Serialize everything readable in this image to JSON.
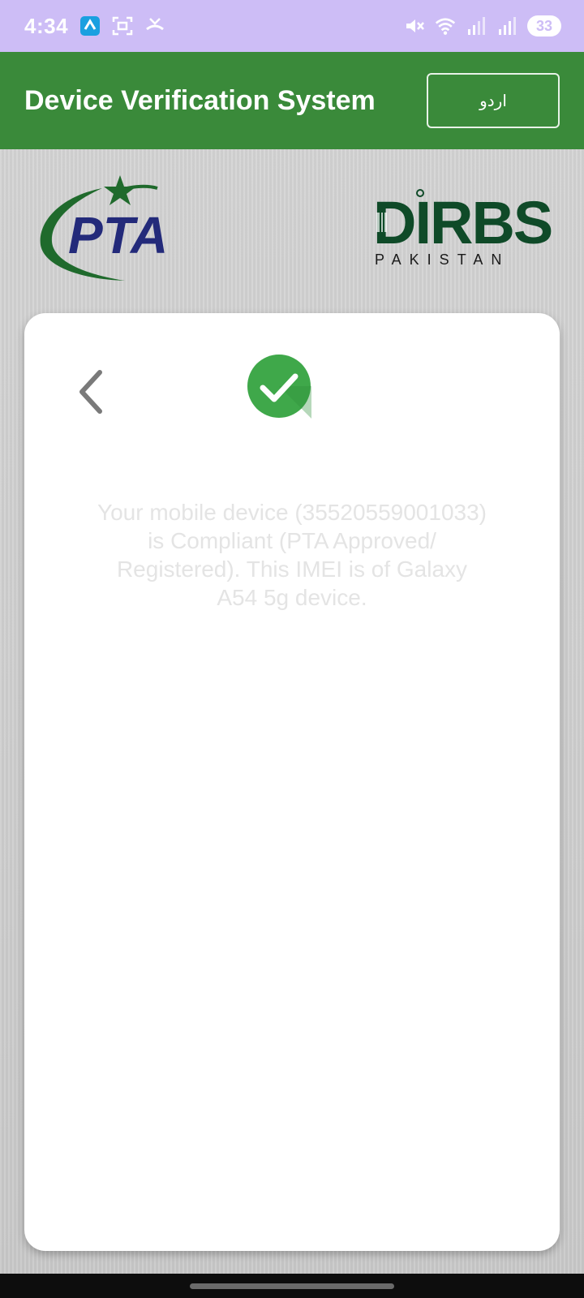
{
  "status_bar": {
    "time": "4:34",
    "battery": "33",
    "icons": [
      "telenor-icon",
      "screenshot-icon",
      "missed-call-icon",
      "mute-icon",
      "wifi-icon",
      "signal-icon",
      "signal-icon-2"
    ]
  },
  "app_bar": {
    "title": "Device Verification System",
    "language_button": "اردو"
  },
  "logos": {
    "left": "PTA",
    "right_main": "DIRBS",
    "right_sub": "PAKISTAN"
  },
  "result": {
    "status_icon": "check-icon",
    "message": "Your mobile device (35520559001033) is Compliant (PTA Approved/ Registered). This IMEI is of Galaxy A54 5g device."
  },
  "colors": {
    "status_bar": "#cdbdf6",
    "app_bar": "#3a8a3a",
    "check": "#3fa84a",
    "pta_blue": "#232a7a",
    "pta_green": "#1f6a2c",
    "dirbs_green": "#0f4a28"
  }
}
